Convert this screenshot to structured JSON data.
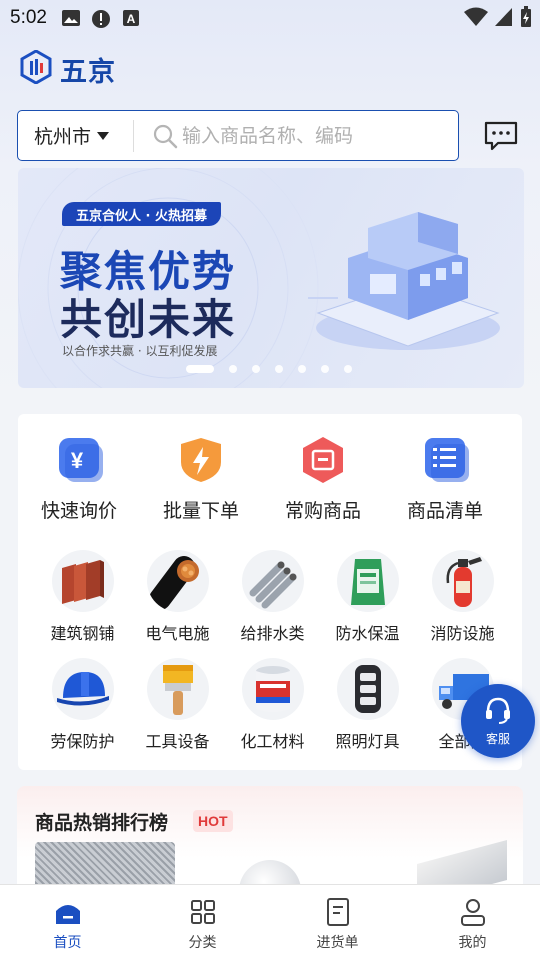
{
  "status_bar": {
    "time": "5:02"
  },
  "header": {
    "logo_text": "五京"
  },
  "search": {
    "city": "杭州市",
    "placeholder": "输入商品名称、编码"
  },
  "banner": {
    "tag": "五京合伙人 · 火热招募",
    "headline_1": "聚焦优势",
    "headline_2": "共创未来",
    "subtitle": "以合作求共赢 · 以互利促发展",
    "dot_count": 7,
    "active_dot": 0
  },
  "quick_actions": [
    {
      "label": "快速询价",
      "icon": "yen-icon"
    },
    {
      "label": "批量下单",
      "icon": "lightning-shield-icon"
    },
    {
      "label": "常购商品",
      "icon": "cart-box-icon"
    },
    {
      "label": "商品清单",
      "icon": "list-icon"
    }
  ],
  "categories_row_1": [
    {
      "label": "建筑钢铺",
      "icon": "steel-plates-icon"
    },
    {
      "label": "电气电施",
      "icon": "cable-icon"
    },
    {
      "label": "给排水类",
      "icon": "pipes-icon"
    },
    {
      "label": "防水保温",
      "icon": "waterproof-bag-icon"
    },
    {
      "label": "消防设施",
      "icon": "fire-extinguisher-icon"
    }
  ],
  "categories_row_2": [
    {
      "label": "劳保防护",
      "icon": "safety-helmet-icon"
    },
    {
      "label": "工具设备",
      "icon": "paint-brush-icon"
    },
    {
      "label": "化工材料",
      "icon": "paint-bucket-icon"
    },
    {
      "label": "照明灯具",
      "icon": "light-fixture-icon"
    },
    {
      "label": "全部分",
      "icon": "truck-icon"
    }
  ],
  "customer_service": {
    "label": "客服"
  },
  "hot_section": {
    "title": "商品热销排行榜",
    "badge": "HOT"
  },
  "bottom_nav": [
    {
      "label": "首页",
      "icon": "home-icon",
      "active": true
    },
    {
      "label": "分类",
      "icon": "grid-icon",
      "active": false
    },
    {
      "label": "进货单",
      "icon": "order-sheet-icon",
      "active": false
    },
    {
      "label": "我的",
      "icon": "user-icon",
      "active": false
    }
  ],
  "colors": {
    "brand": "#1b4fc1",
    "hot": "#e03a3a"
  }
}
